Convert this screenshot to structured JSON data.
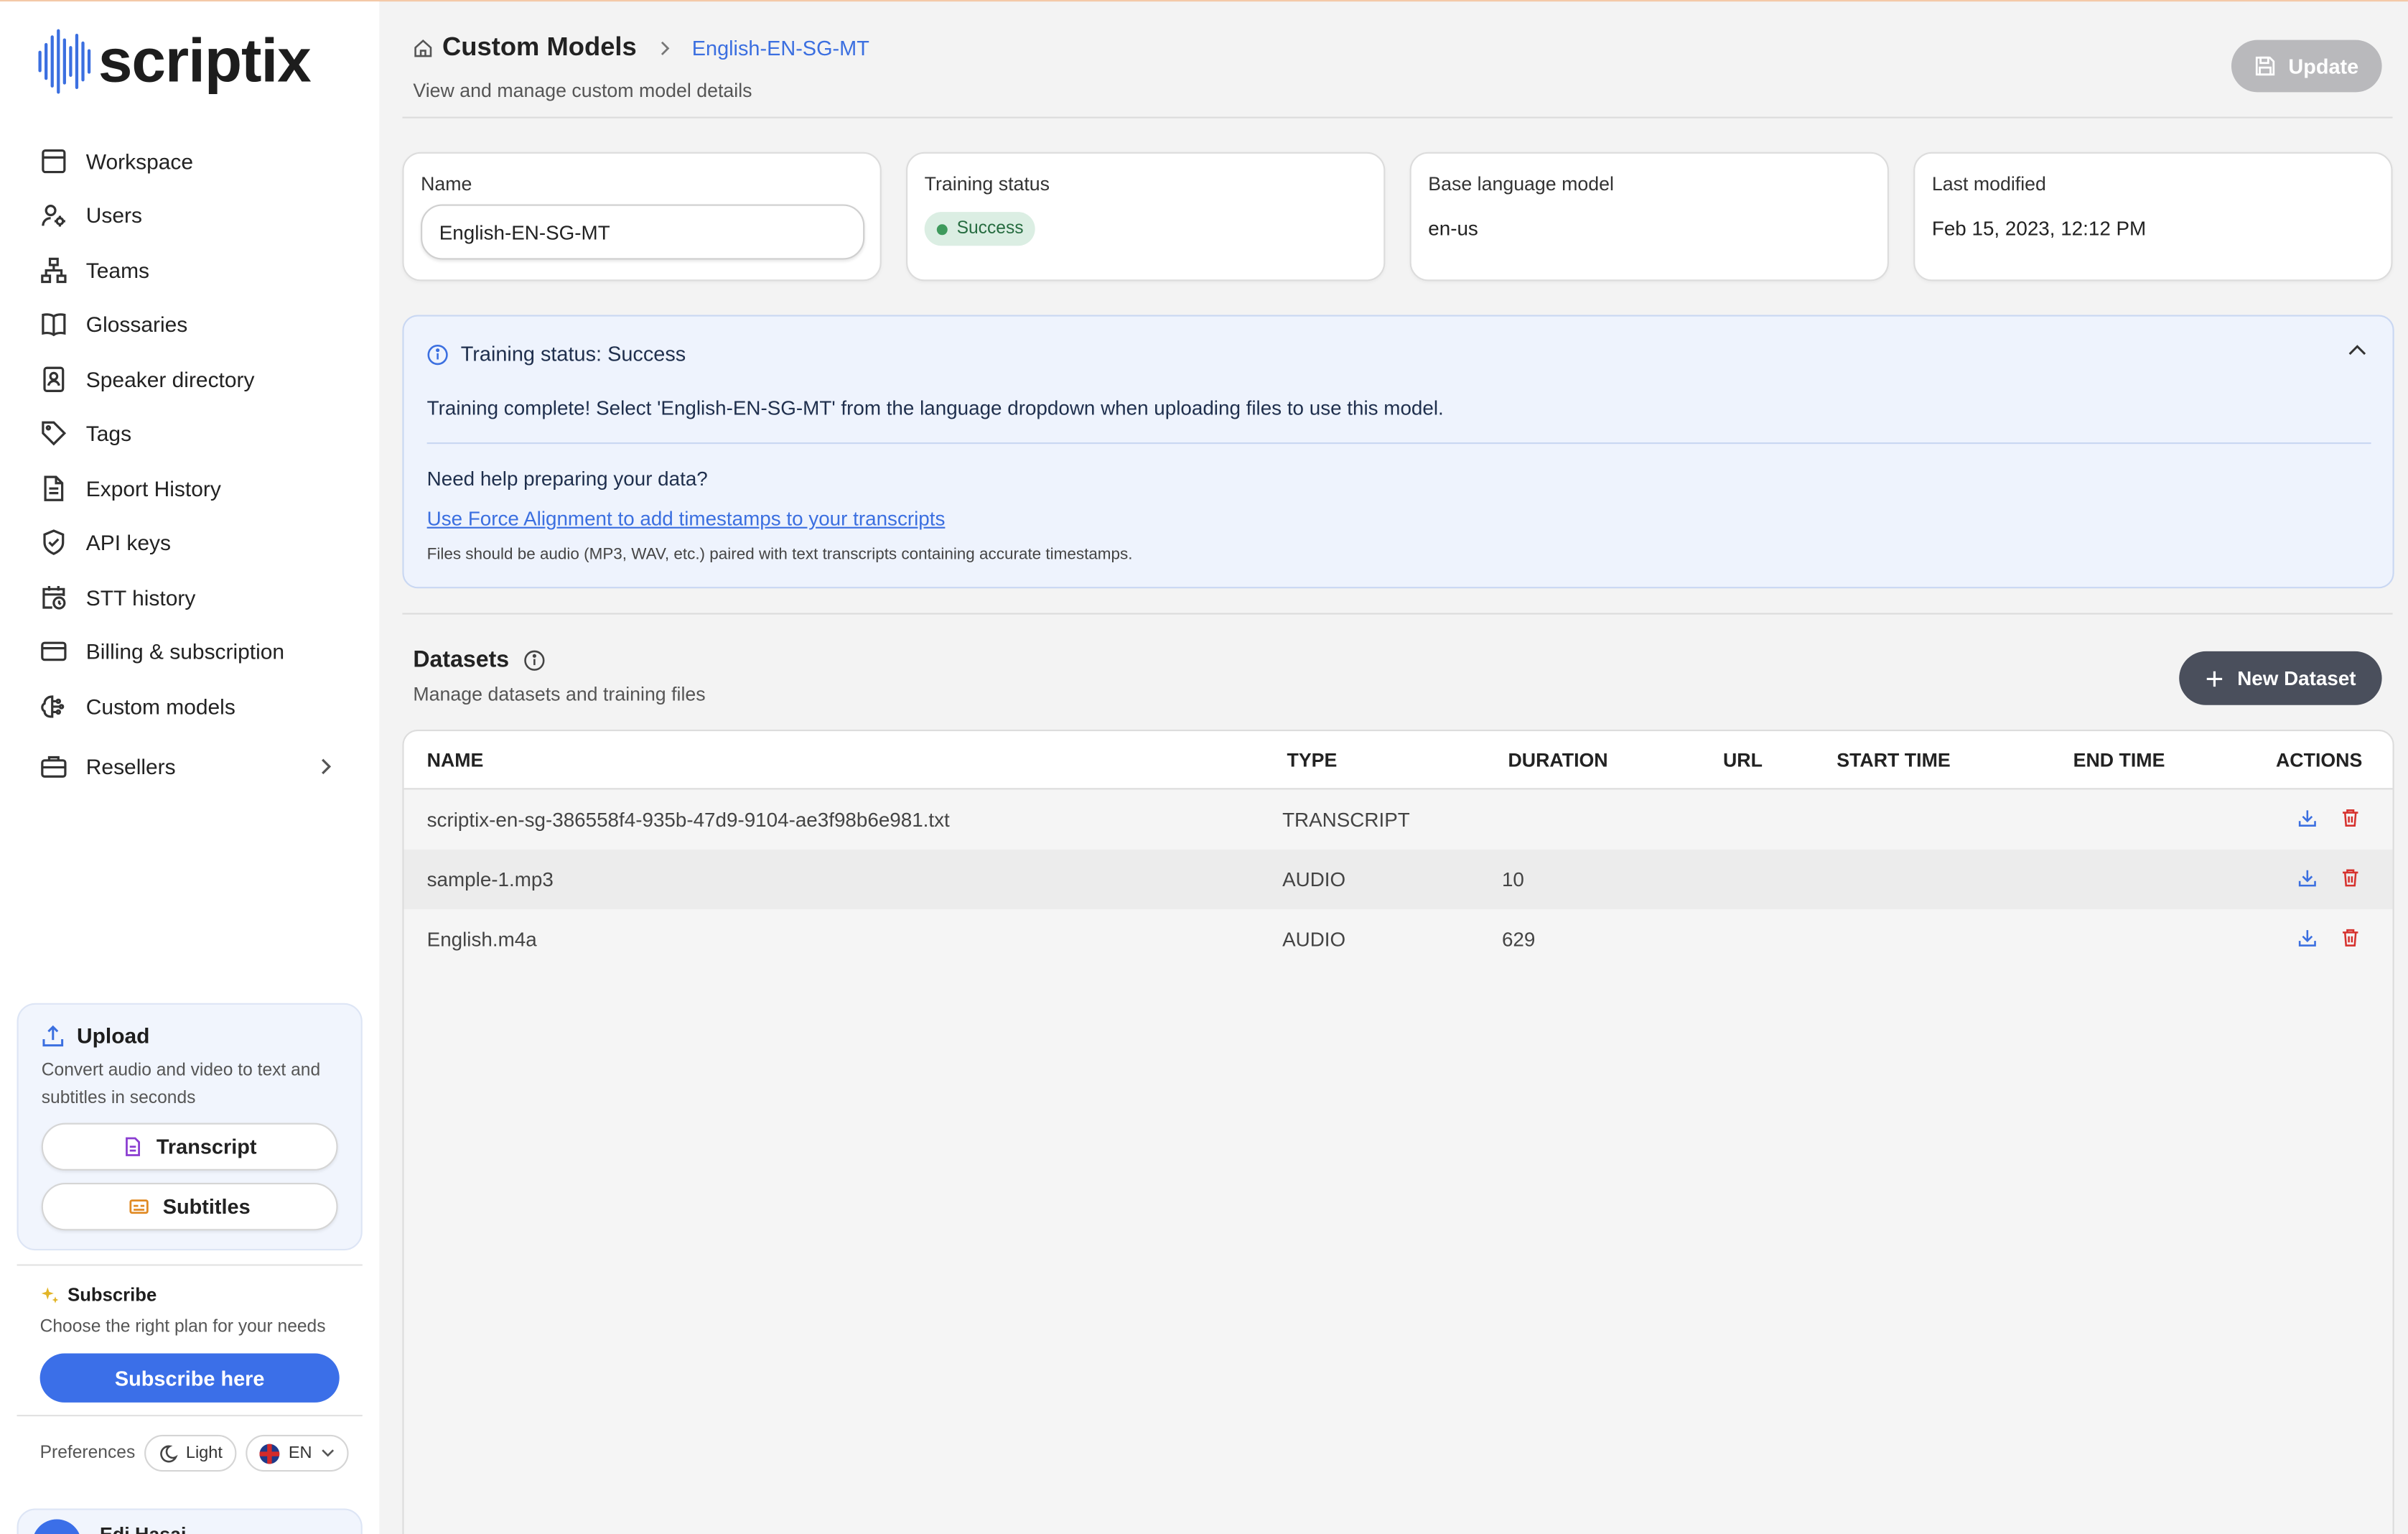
{
  "brand": {
    "name": "scriptix",
    "accent": "#3b6fe0"
  },
  "sidebar": {
    "items": [
      {
        "label": "Workspace",
        "icon": "layout-icon"
      },
      {
        "label": "Users",
        "icon": "users-icon"
      },
      {
        "label": "Teams",
        "icon": "teams-icon"
      },
      {
        "label": "Glossaries",
        "icon": "book-icon"
      },
      {
        "label": "Speaker directory",
        "icon": "contact-icon"
      },
      {
        "label": "Tags",
        "icon": "tag-icon"
      },
      {
        "label": "Export History",
        "icon": "file-icon"
      },
      {
        "label": "API keys",
        "icon": "shield-icon"
      },
      {
        "label": "STT history",
        "icon": "calendar-clock-icon"
      },
      {
        "label": "Billing & subscription",
        "icon": "credit-card-icon"
      },
      {
        "label": "Custom models",
        "icon": "brain-icon"
      }
    ],
    "resellers": {
      "label": "Resellers",
      "icon": "briefcase-icon"
    },
    "upload": {
      "title": "Upload",
      "description": "Convert audio and video to text and subtitles in seconds",
      "transcript_label": "Transcript",
      "subtitles_label": "Subtitles"
    },
    "subscribe": {
      "title": "Subscribe",
      "description": "Choose the right plan for your needs",
      "button": "Subscribe here"
    },
    "preferences": {
      "label": "Preferences",
      "theme": "Light",
      "language": "EN"
    },
    "user": {
      "name": "Edi Hasai"
    }
  },
  "header": {
    "title": "Custom Models",
    "current": "English-EN-SG-MT",
    "subtitle": "View and manage custom model details",
    "update_label": "Update"
  },
  "cards": {
    "name_label": "Name",
    "name_value": "English-EN-SG-MT",
    "status_label": "Training status",
    "status_value": "Success",
    "base_label": "Base language model",
    "base_value": "en-us",
    "modified_label": "Last modified",
    "modified_value": "Feb 15, 2023, 12:12 PM"
  },
  "info": {
    "heading": "Training status: Success",
    "message": "Training complete! Select 'English-EN-SG-MT' from the language dropdown when uploading files to use this model.",
    "question": "Need help preparing your data?",
    "link": "Use Force Alignment to add timestamps to your transcripts",
    "note": "Files should be audio (MP3, WAV, etc.) paired with text transcripts containing accurate timestamps."
  },
  "datasets": {
    "title": "Datasets",
    "subtitle": "Manage datasets and training files",
    "new_label": "New Dataset",
    "columns": [
      "NAME",
      "TYPE",
      "DURATION",
      "URL",
      "START TIME",
      "END TIME",
      "ACTIONS"
    ],
    "rows": [
      {
        "name": "scriptix-en-sg-386558f4-935b-47d9-9104-ae3f98b6e981.txt",
        "type": "TRANSCRIPT",
        "duration": "",
        "url": "",
        "start": "",
        "end": ""
      },
      {
        "name": "sample-1.mp3",
        "type": "AUDIO",
        "duration": "10",
        "url": "",
        "start": "",
        "end": ""
      },
      {
        "name": "English.m4a",
        "type": "AUDIO",
        "duration": "629",
        "url": "",
        "start": "",
        "end": ""
      }
    ]
  }
}
